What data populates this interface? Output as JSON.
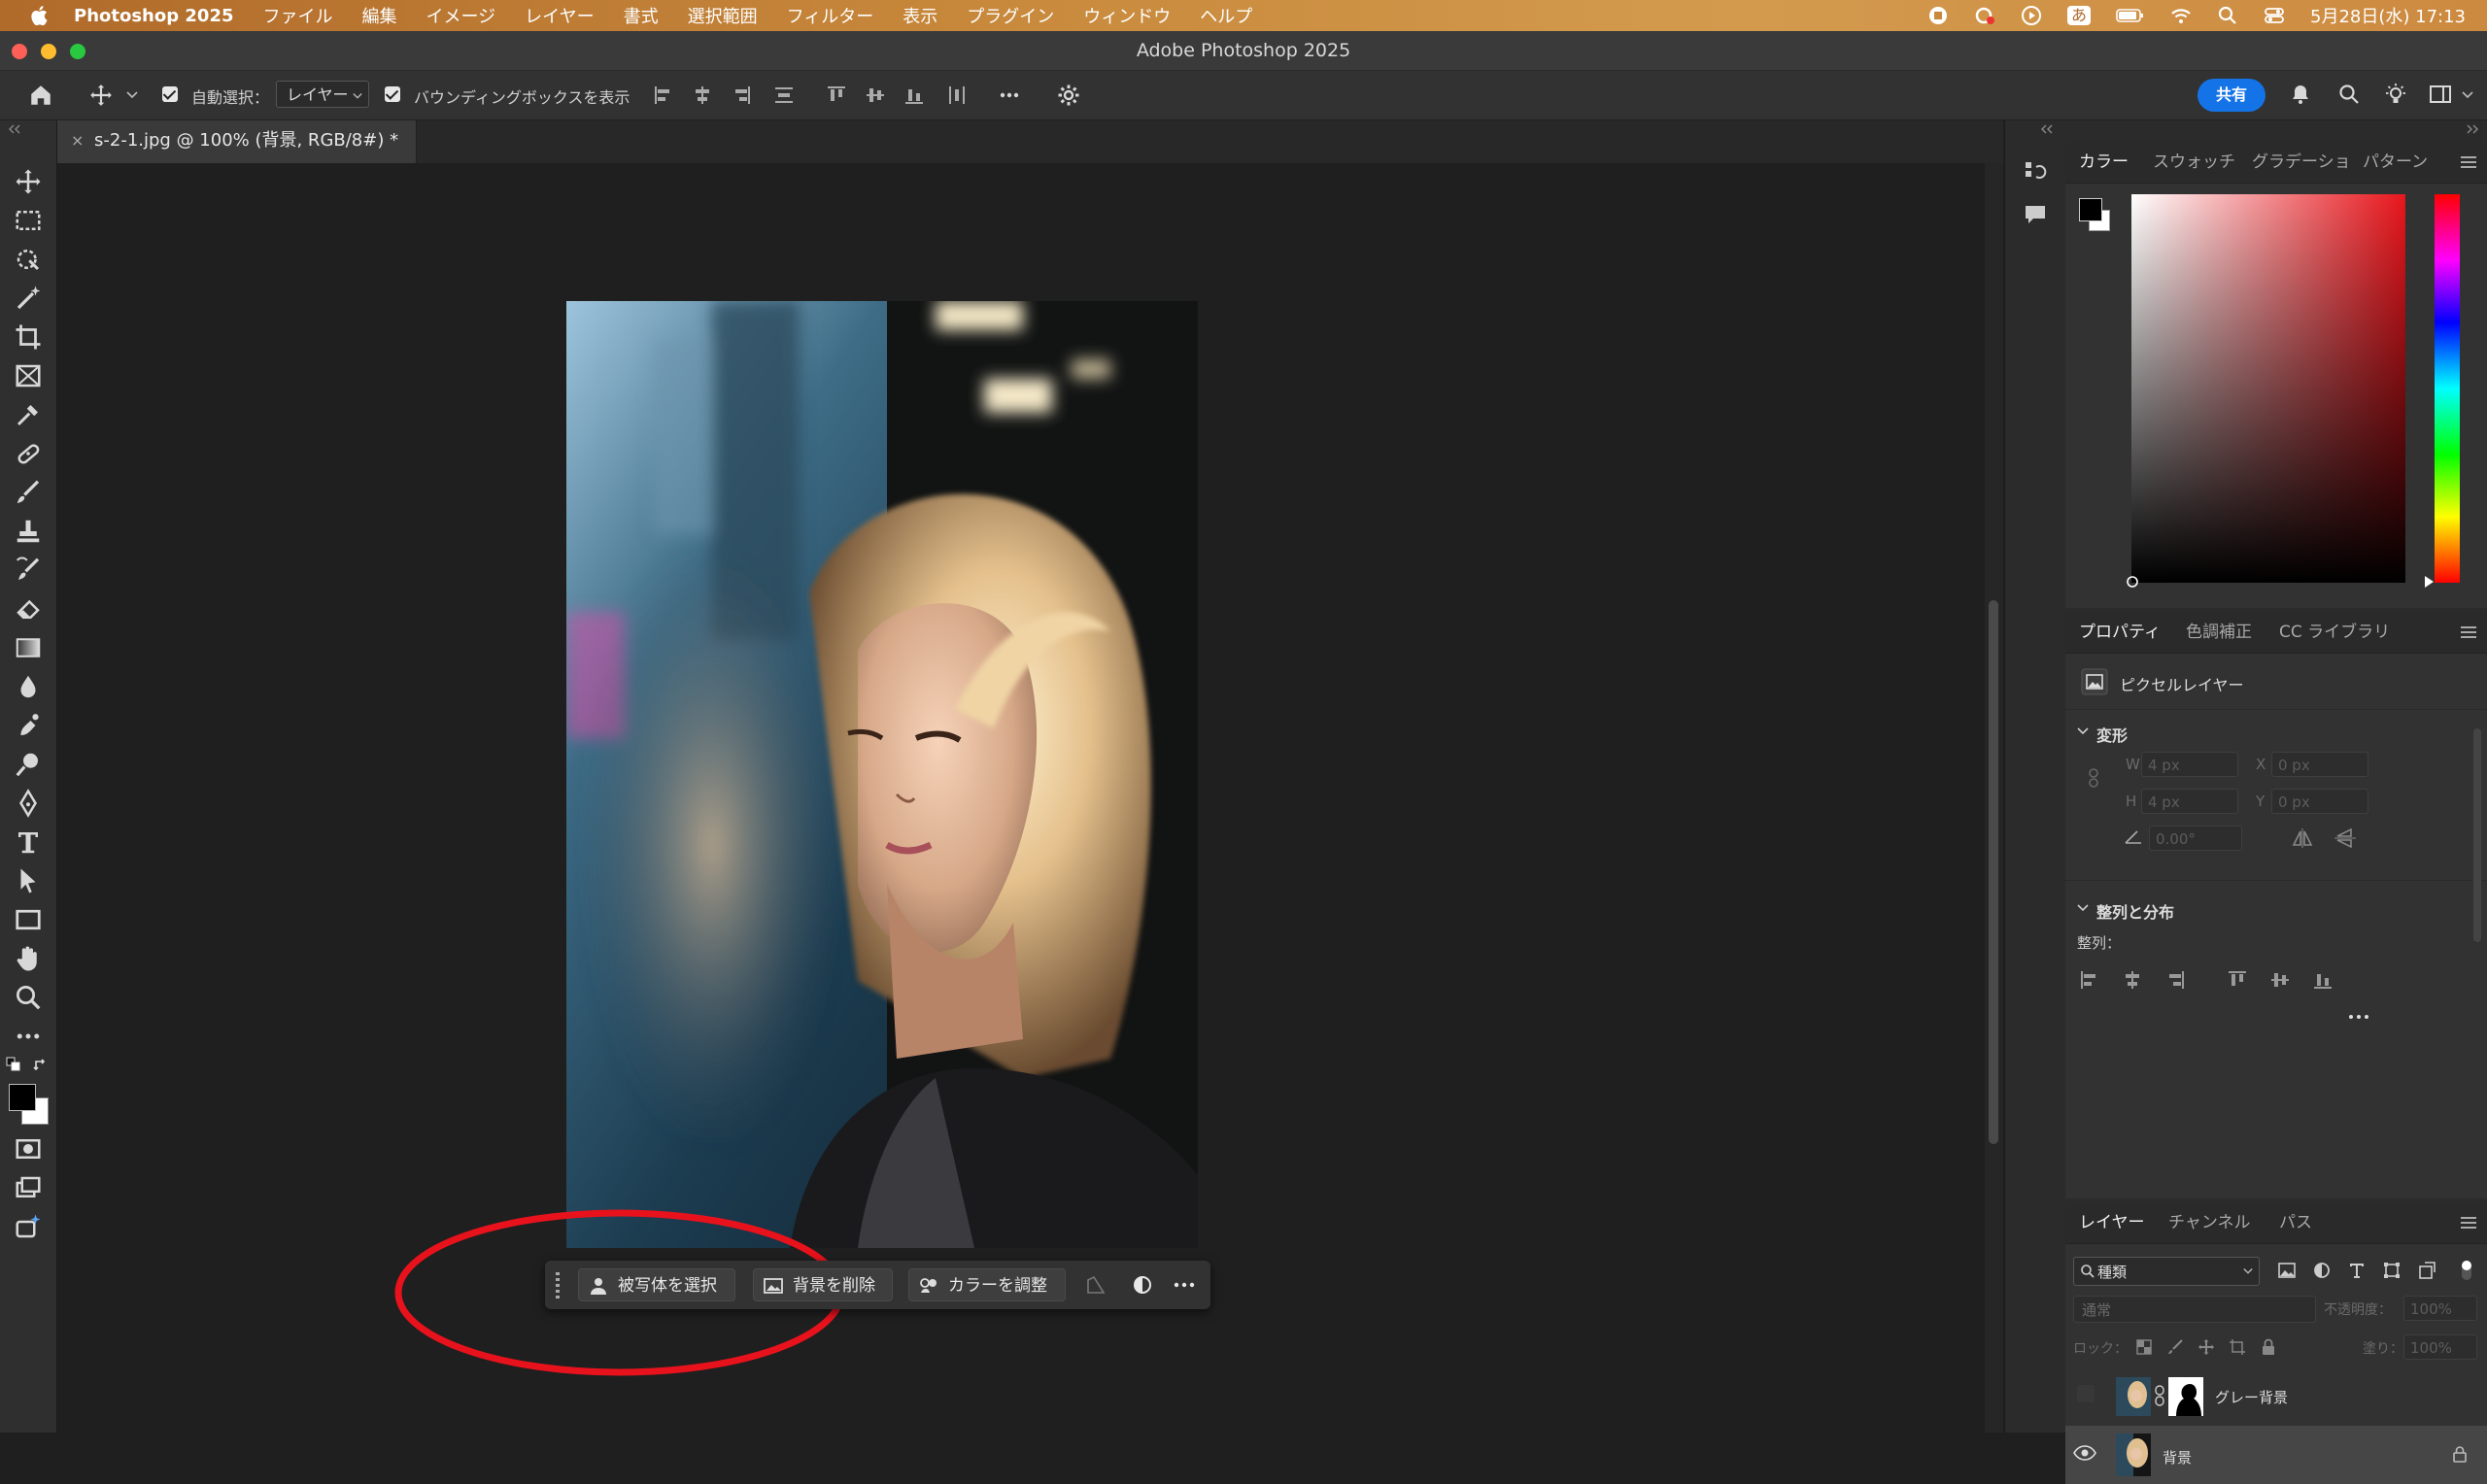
{
  "menubar": {
    "app_name": "Photoshop 2025",
    "items": [
      "ファイル",
      "編集",
      "イメージ",
      "レイヤー",
      "書式",
      "選択範囲",
      "フィルター",
      "表示",
      "プラグイン",
      "ウィンドウ",
      "ヘルプ"
    ],
    "input_method": "あ",
    "datetime": "5月28日(水) 17:13"
  },
  "window": {
    "title": "Adobe Photoshop 2025"
  },
  "options": {
    "auto_select_label": "自動選択：",
    "auto_select_value": "レイヤー",
    "bounding_box_label": "バウンディングボックスを表示",
    "share_label": "共有"
  },
  "document": {
    "tab_title": "s-2-1.jpg @ 100% (背景, RGB/8#) *",
    "close_glyph": "×"
  },
  "context_bar": {
    "select_subject": "被写体を選択",
    "remove_background": "背景を削除",
    "adjust_color": "カラーを調整"
  },
  "color_panel": {
    "tabs": [
      "カラー",
      "スウォッチ",
      "グラデーショ",
      "パターン"
    ],
    "foreground": "#000000",
    "background": "#ffffff",
    "hue_color": "#e8161c"
  },
  "properties_panel": {
    "tabs": [
      "プロパティ",
      "色調補正",
      "CC ライブラリ"
    ],
    "layer_type": "ピクセルレイヤー",
    "transform_label": "変形",
    "w_label": "W",
    "w_value": "4 px",
    "x_label": "X",
    "x_value": "0 px",
    "h_label": "H",
    "h_value": "4 px",
    "y_label": "Y",
    "y_value": "0 px",
    "angle_value": "0.00°",
    "align_label": "整列と分布",
    "align_sub": "整列："
  },
  "layers_panel": {
    "tabs": [
      "レイヤー",
      "チャンネル",
      "パス"
    ],
    "filter_value": "種類",
    "blend_mode": "通常",
    "opacity_label": "不透明度：",
    "opacity_value": "100%",
    "lock_label": "ロック：",
    "fill_label": "塗り：",
    "fill_value": "100%",
    "layers": [
      {
        "name": "グレー背景",
        "visible": false,
        "has_mask": true
      },
      {
        "name": "背景",
        "visible": true,
        "locked": true
      }
    ]
  }
}
